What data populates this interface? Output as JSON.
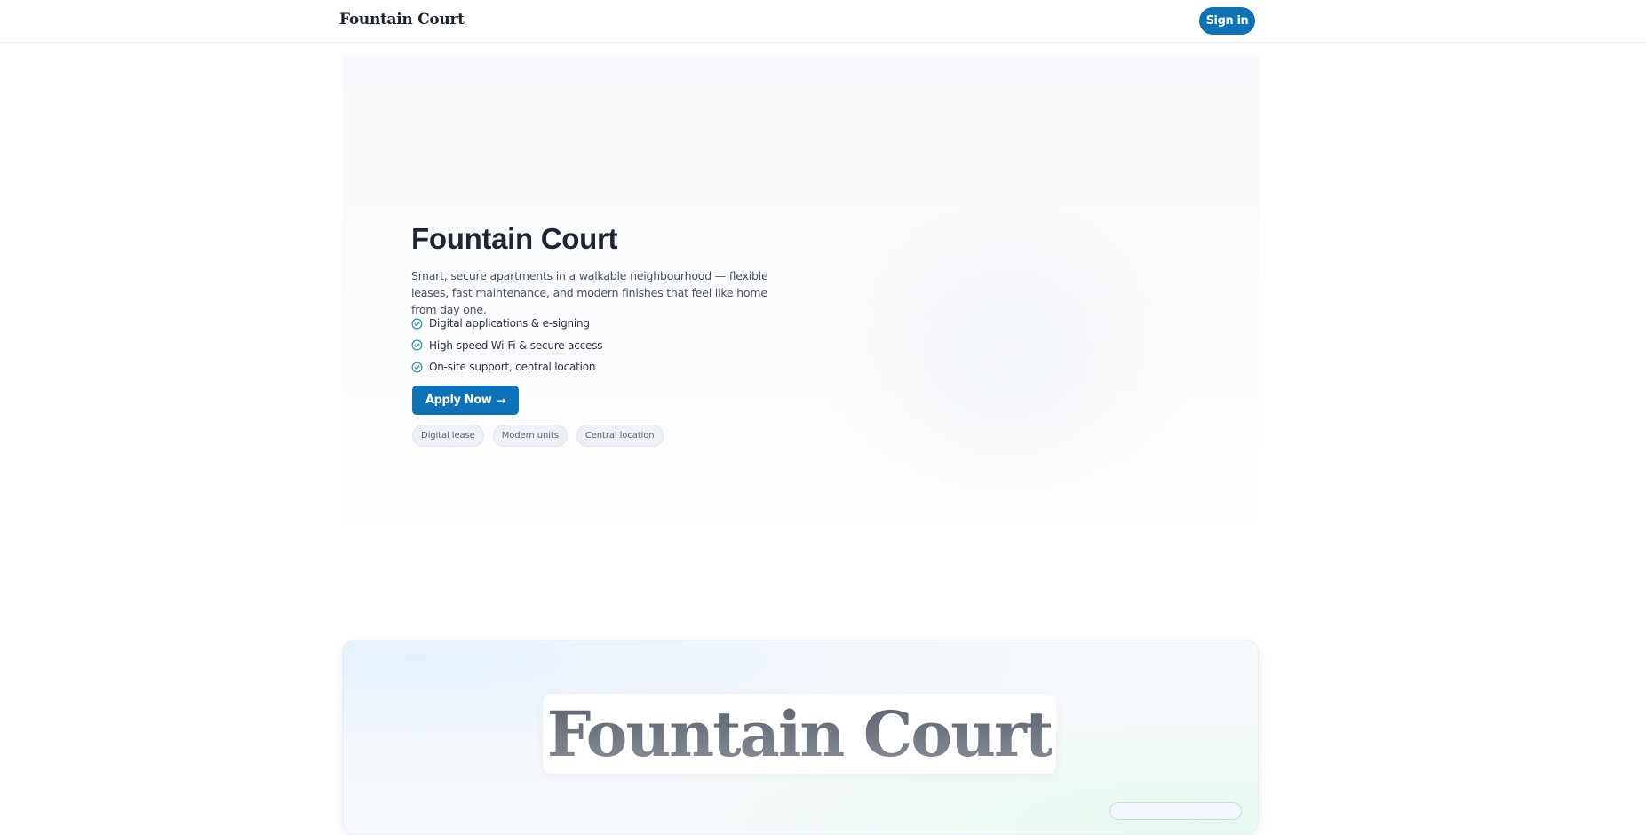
{
  "header": {
    "brand": "Fountain Court",
    "signin_label": "Sign in"
  },
  "hero": {
    "title": "Fountain Court",
    "description": "Smart, secure apartments in a walkable neighbourhood — flexible leases, fast maintenance, and modern finishes that feel like home from day one.",
    "features": [
      {
        "label": "Digital applications & e-signing",
        "icon": "check-circle-icon"
      },
      {
        "label": "High-speed Wi-Fi & secure access",
        "icon": "check-circle-icon"
      },
      {
        "label": "On-site support, central location",
        "icon": "check-circle-icon"
      }
    ],
    "cta_label": "Apply Now",
    "cta_icon": "arrow-right-icon",
    "tags": [
      "Digital lease",
      "Modern units",
      "Central location"
    ]
  },
  "showcase": {
    "title": "Fountain Court"
  },
  "colors": {
    "accent": "#0e72b8",
    "check": "#1f8fb0",
    "text_dark": "#1f2533"
  }
}
